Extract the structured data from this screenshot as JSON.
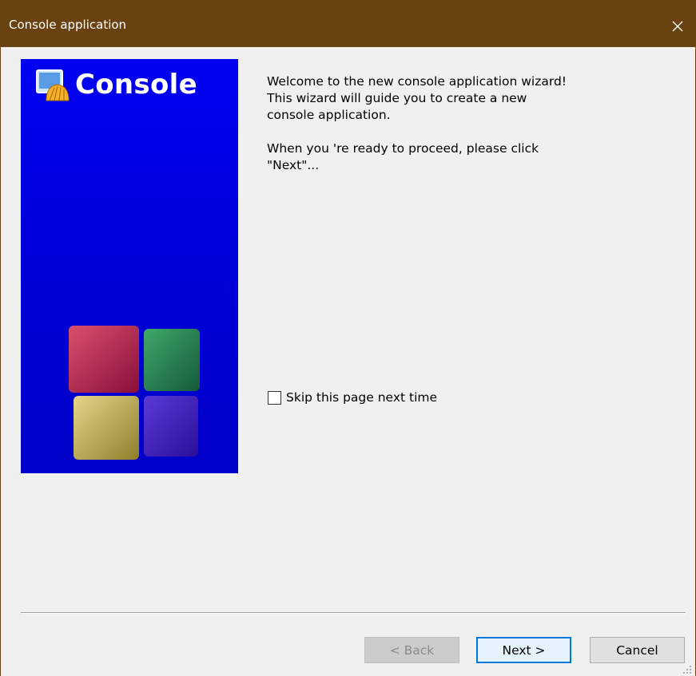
{
  "window": {
    "title": "Console application",
    "colors": {
      "titlebar": "#6a4211",
      "banner": "#0000e0",
      "accent": "#0078d7"
    }
  },
  "banner": {
    "logo_text": "Console",
    "icon": "codeblocks-shell-icon"
  },
  "content": {
    "welcome_text": "Welcome to the new console application wizard!\nThis wizard will guide you to create a new\nconsole application.",
    "proceed_text": "When you 're ready to proceed, please click\n\"Next\"..."
  },
  "options": {
    "skip_label": "Skip this page next time",
    "skip_checked": false
  },
  "buttons": {
    "back_label": "< Back",
    "next_label": "Next >",
    "cancel_label": "Cancel"
  }
}
